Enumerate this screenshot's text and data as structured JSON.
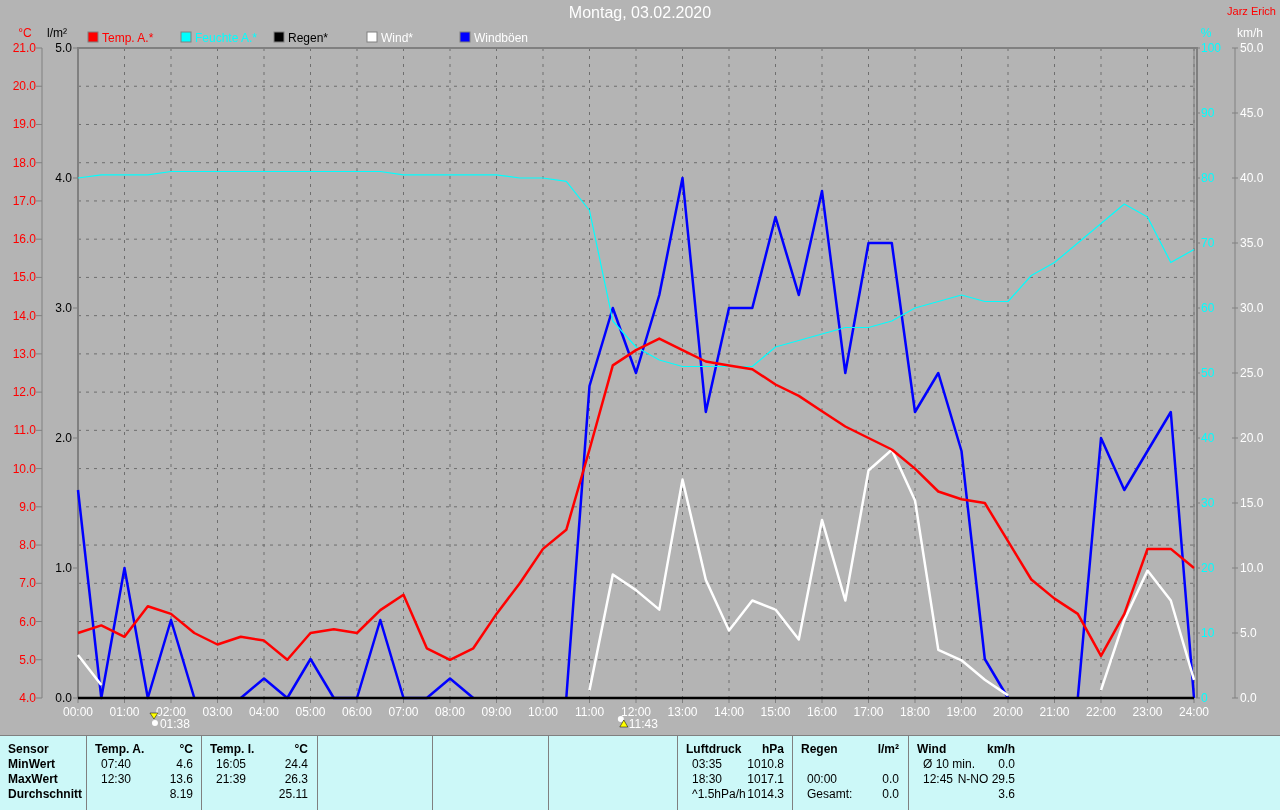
{
  "title": "Montag, 03.02.2020",
  "author": "Jarz Erich",
  "axis_units": [
    {
      "text": "°C",
      "color": "#ff0000"
    },
    {
      "text": "l/m²",
      "color": "#000000"
    },
    {
      "text": "%",
      "color": "#00ffff"
    },
    {
      "text": "km/h",
      "color": "#ffffff"
    }
  ],
  "rain_axis_ticks": [
    "5.0",
    "4.0",
    "3.0",
    "2.0",
    "1.0",
    "0.0"
  ],
  "legend_labels": [
    {
      "color": "#ff0000"
    },
    {
      "color": "#00ffff"
    },
    {
      "color": "#000000"
    },
    {
      "color": "#ffffff"
    },
    {
      "color": "#ffffff"
    }
  ],
  "x_markers": [
    {
      "kind": "down",
      "time": "01:38"
    },
    {
      "kind": "up",
      "time": "11:43"
    }
  ],
  "chart_data": {
    "type": "line",
    "grid": true,
    "legend": "top",
    "xlim": [
      0,
      24
    ],
    "ylim": [
      4,
      21
    ],
    "y2lim": [
      0,
      100
    ],
    "y3lim": [
      0,
      50
    ],
    "x": [
      0,
      0.5,
      1,
      1.5,
      2,
      2.5,
      3,
      3.5,
      4,
      4.5,
      5,
      5.5,
      6,
      6.5,
      7,
      7.5,
      8,
      8.5,
      9,
      9.5,
      10,
      10.5,
      11,
      11.5,
      12,
      12.5,
      13,
      13.5,
      14,
      14.5,
      15,
      15.5,
      16,
      16.5,
      17,
      17.5,
      18,
      18.5,
      19,
      19.5,
      20,
      20.5,
      21,
      21.5,
      22,
      22.5,
      23,
      23.5,
      24
    ],
    "xticks": [
      {
        "value": 0,
        "label": "00:00"
      },
      {
        "value": 1,
        "label": "01:00"
      },
      {
        "value": 2,
        "label": "02:00"
      },
      {
        "value": 3,
        "label": "03:00"
      },
      {
        "value": 4,
        "label": "04:00"
      },
      {
        "value": 5,
        "label": "05:00"
      },
      {
        "value": 6,
        "label": "06:00"
      },
      {
        "value": 7,
        "label": "07:00"
      },
      {
        "value": 8,
        "label": "08:00"
      },
      {
        "value": 9,
        "label": "09:00"
      },
      {
        "value": 10,
        "label": "10:00"
      },
      {
        "value": 11,
        "label": "11:00"
      },
      {
        "value": 12,
        "label": "12:00"
      },
      {
        "value": 13,
        "label": "13:00"
      },
      {
        "value": 14,
        "label": "14:00"
      },
      {
        "value": 15,
        "label": "15:00"
      },
      {
        "value": 16,
        "label": "16:00"
      },
      {
        "value": 17,
        "label": "17:00"
      },
      {
        "value": 18,
        "label": "18:00"
      },
      {
        "value": 19,
        "label": "19:00"
      },
      {
        "value": 20,
        "label": "20:00"
      },
      {
        "value": 21,
        "label": "21:00"
      },
      {
        "value": 22,
        "label": "22:00"
      },
      {
        "value": 23,
        "label": "23:00"
      },
      {
        "value": 24,
        "label": "24:00"
      }
    ],
    "yticks": [
      {
        "value": 4,
        "label": "4.0"
      },
      {
        "value": 5,
        "label": "5.0"
      },
      {
        "value": 6,
        "label": "6.0"
      },
      {
        "value": 7,
        "label": "7.0"
      },
      {
        "value": 8,
        "label": "8.0"
      },
      {
        "value": 9,
        "label": "9.0"
      },
      {
        "value": 10,
        "label": "10.0"
      },
      {
        "value": 11,
        "label": "11.0"
      },
      {
        "value": 12,
        "label": "12.0"
      },
      {
        "value": 13,
        "label": "13.0"
      },
      {
        "value": 14,
        "label": "14.0"
      },
      {
        "value": 15,
        "label": "15.0"
      },
      {
        "value": 16,
        "label": "16.0"
      },
      {
        "value": 17,
        "label": "17.0"
      },
      {
        "value": 18,
        "label": "18.0"
      },
      {
        "value": 19,
        "label": "19.0"
      },
      {
        "value": 20,
        "label": "20.0"
      },
      {
        "value": 21,
        "label": "21.0"
      }
    ],
    "y2ticks": [
      {
        "value": 0,
        "label": "0"
      },
      {
        "value": 10,
        "label": "10"
      },
      {
        "value": 20,
        "label": "20"
      },
      {
        "value": 30,
        "label": "30"
      },
      {
        "value": 40,
        "label": "40"
      },
      {
        "value": 50,
        "label": "50"
      },
      {
        "value": 60,
        "label": "60"
      },
      {
        "value": 70,
        "label": "70"
      },
      {
        "value": 80,
        "label": "80"
      },
      {
        "value": 90,
        "label": "90"
      },
      {
        "value": 100,
        "label": "100"
      }
    ],
    "y3ticks": [
      {
        "value": 0,
        "label": "0.0"
      },
      {
        "value": 5,
        "label": "5.0"
      },
      {
        "value": 10,
        "label": "10.0"
      },
      {
        "value": 15,
        "label": "15.0"
      },
      {
        "value": 20,
        "label": "20.0"
      },
      {
        "value": 25,
        "label": "25.0"
      },
      {
        "value": 30,
        "label": "30.0"
      },
      {
        "value": 35,
        "label": "35.0"
      },
      {
        "value": 40,
        "label": "40.0"
      },
      {
        "value": 45,
        "label": "45.0"
      },
      {
        "value": 50,
        "label": "50.0"
      }
    ],
    "series": [
      {
        "name": "Temp. A.*",
        "color": "#ff0000",
        "values": [
          5.7,
          5.9,
          5.6,
          6.4,
          6.2,
          5.7,
          5.4,
          5.6,
          5.5,
          5.0,
          5.7,
          5.8,
          5.7,
          6.3,
          6.7,
          5.3,
          5.0,
          5.3,
          6.2,
          7.0,
          7.9,
          8.4,
          10.5,
          12.7,
          13.1,
          13.4,
          13.1,
          12.8,
          12.7,
          12.6,
          12.2,
          11.9,
          11.5,
          11.1,
          10.8,
          10.5,
          10.0,
          9.4,
          9.2,
          9.1,
          8.1,
          7.1,
          6.6,
          6.2,
          5.1,
          6.2,
          7.9,
          7.9,
          7.4
        ]
      },
      {
        "name": "Feuchte A.*",
        "color": "#00ffff",
        "axis": "y2",
        "values": [
          80,
          80.5,
          80.5,
          80.5,
          81,
          81,
          81,
          81,
          81,
          81,
          81,
          81,
          81,
          81,
          80.5,
          80.5,
          80.5,
          80.5,
          80.5,
          80,
          80,
          79.5,
          75,
          58,
          54,
          52,
          51,
          51,
          51,
          51,
          54,
          55,
          56,
          57,
          57,
          58,
          60,
          61,
          62,
          61,
          61,
          65,
          67,
          70,
          73,
          76,
          74,
          67,
          69
        ]
      },
      {
        "name": "Regen*",
        "color": "#000000",
        "axis": "y3",
        "values": [
          0,
          0,
          0,
          0,
          0,
          0,
          0,
          0,
          0,
          0,
          0,
          0,
          0,
          0,
          0,
          0,
          0,
          0,
          0,
          0,
          0,
          0,
          0,
          0,
          0,
          0,
          0,
          0,
          0,
          0,
          0,
          0,
          0,
          0,
          0,
          0,
          0,
          0,
          0,
          0,
          0,
          0,
          0,
          0,
          0,
          0,
          0,
          0,
          0
        ]
      },
      {
        "name": "Wind*",
        "color": "#ffffff",
        "axis": "y3",
        "values": [
          3.3,
          1.0,
          null,
          null,
          null,
          null,
          null,
          null,
          null,
          null,
          null,
          null,
          null,
          null,
          null,
          null,
          null,
          null,
          null,
          null,
          null,
          null,
          0.6,
          9.5,
          8.3,
          6.8,
          16.8,
          9.1,
          5.2,
          7.5,
          6.8,
          4.5,
          13.7,
          7.5,
          17.5,
          19.1,
          15.2,
          3.7,
          2.9,
          1.4,
          0.2,
          null,
          null,
          null,
          0.6,
          6.0,
          9.8,
          7.5,
          1.4
        ]
      },
      {
        "name": "Windböen",
        "color": "#0000ff",
        "axis": "y3",
        "values": [
          16,
          0,
          10,
          0,
          6,
          0,
          null,
          0,
          1.5,
          0,
          3,
          0,
          0,
          6,
          0,
          0,
          1.5,
          0,
          null,
          null,
          null,
          0,
          24,
          30,
          25,
          31,
          40,
          22,
          30,
          30,
          37,
          31,
          39,
          25,
          35,
          35,
          22,
          25,
          19,
          3,
          0,
          null,
          null,
          0,
          20,
          16,
          19,
          22,
          0
        ]
      }
    ]
  },
  "summary": {
    "labels": [
      "Sensor",
      "MinWert",
      "MaxWert",
      "Durchschnitt"
    ],
    "sections": [
      {
        "kind": "data",
        "title": "Temp. A.",
        "unit": "°C",
        "rows": [
          {
            "time": "07:40",
            "value": "4.6"
          },
          {
            "time": "12:30",
            "value": "13.6"
          },
          {
            "value": "8.19"
          }
        ]
      },
      {
        "kind": "data",
        "title": "Temp. I.",
        "unit": "°C",
        "rows": [
          {
            "time": "16:05",
            "value": "24.4"
          },
          {
            "time": "21:39",
            "value": "26.3"
          },
          {
            "value": "25.11"
          }
        ]
      },
      {
        "kind": "empty"
      },
      {
        "kind": "empty"
      },
      {
        "kind": "empty"
      },
      {
        "kind": "data",
        "title": "Luftdruck",
        "unit": "hPa",
        "rows": [
          {
            "time": "03:35",
            "value": "1010.8"
          },
          {
            "time": "18:30",
            "value": "1017.1"
          },
          {
            "time": "^1.5hPa/h",
            "value": "1014.3"
          }
        ]
      },
      {
        "kind": "data",
        "title": "Regen",
        "unit": "l/m²",
        "rows": [
          {},
          {
            "time": "00:00",
            "value": "0.0"
          },
          {
            "time": "Gesamt:",
            "value": "0.0"
          }
        ]
      },
      {
        "kind": "data",
        "title": "Wind",
        "unit": "km/h",
        "rows": [
          {
            "time": "Ø 10 min.",
            "value": "0.0"
          },
          {
            "time": "12:45",
            "value": "N-NO 29.5"
          },
          {
            "value": "3.6"
          }
        ]
      }
    ]
  }
}
